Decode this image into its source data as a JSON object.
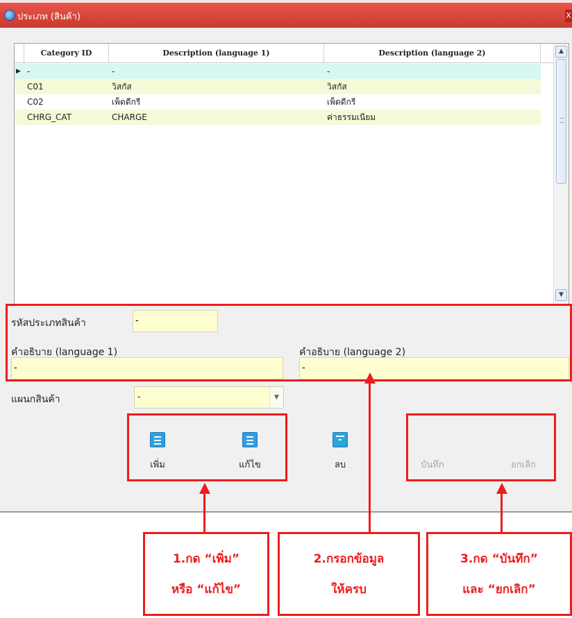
{
  "window": {
    "title": "ประเภท (สินค้า)",
    "close_glyph": "X"
  },
  "grid": {
    "headers": [
      "Category ID",
      "Description (language 1)",
      "Description (language 2)"
    ],
    "current_row_marker": "▶",
    "rows": [
      {
        "id": "-",
        "desc1": "-",
        "desc2": "-",
        "state": "new"
      },
      {
        "id": "C01",
        "desc1": "วิสกัส",
        "desc2": "วิสกัส",
        "state": "alt"
      },
      {
        "id": "C02",
        "desc1": "เพ็ดดีกรี",
        "desc2": "เพ็ดดีกรี",
        "state": "normal"
      },
      {
        "id": "CHRG_CAT",
        "desc1": "CHARGE",
        "desc2": "ค่าธรรมเนียม",
        "state": "alt"
      }
    ]
  },
  "form": {
    "category_code_label": "รหัสประเภทสินค้า",
    "category_code_value": "-",
    "desc1_label": "คำอธิบาย (language 1)",
    "desc1_value": "-",
    "desc2_label": "คำอธิบาย (language 2)",
    "desc2_value": "-",
    "department_label": "แผนกสินค้า",
    "department_value": "-"
  },
  "toolbar": {
    "add_label": "เพิ่ม",
    "edit_label": "แก้ไข",
    "delete_label": "ลบ",
    "save_label": "บันทึก",
    "cancel_label": "ยกเลิก"
  },
  "annotations": {
    "step1_line1": "1.กด “เพิ่ม”",
    "step1_line2": "หรือ “แก้ไข”",
    "step2_line1": "2.กรอกข้อมูล",
    "step2_line2": "ให้ครบ",
    "step3_line1": "3.กด “บันทึก”",
    "step3_line2": "และ “ยกเลิก”"
  },
  "colors": {
    "annotation": "#ee1c1c",
    "title_bar": "#d8463c",
    "input_fill": "#fefed0",
    "row_new": "#d8f6f2",
    "row_alt": "#f6f9d8",
    "toolbar_icon": "#2f9fe0"
  }
}
